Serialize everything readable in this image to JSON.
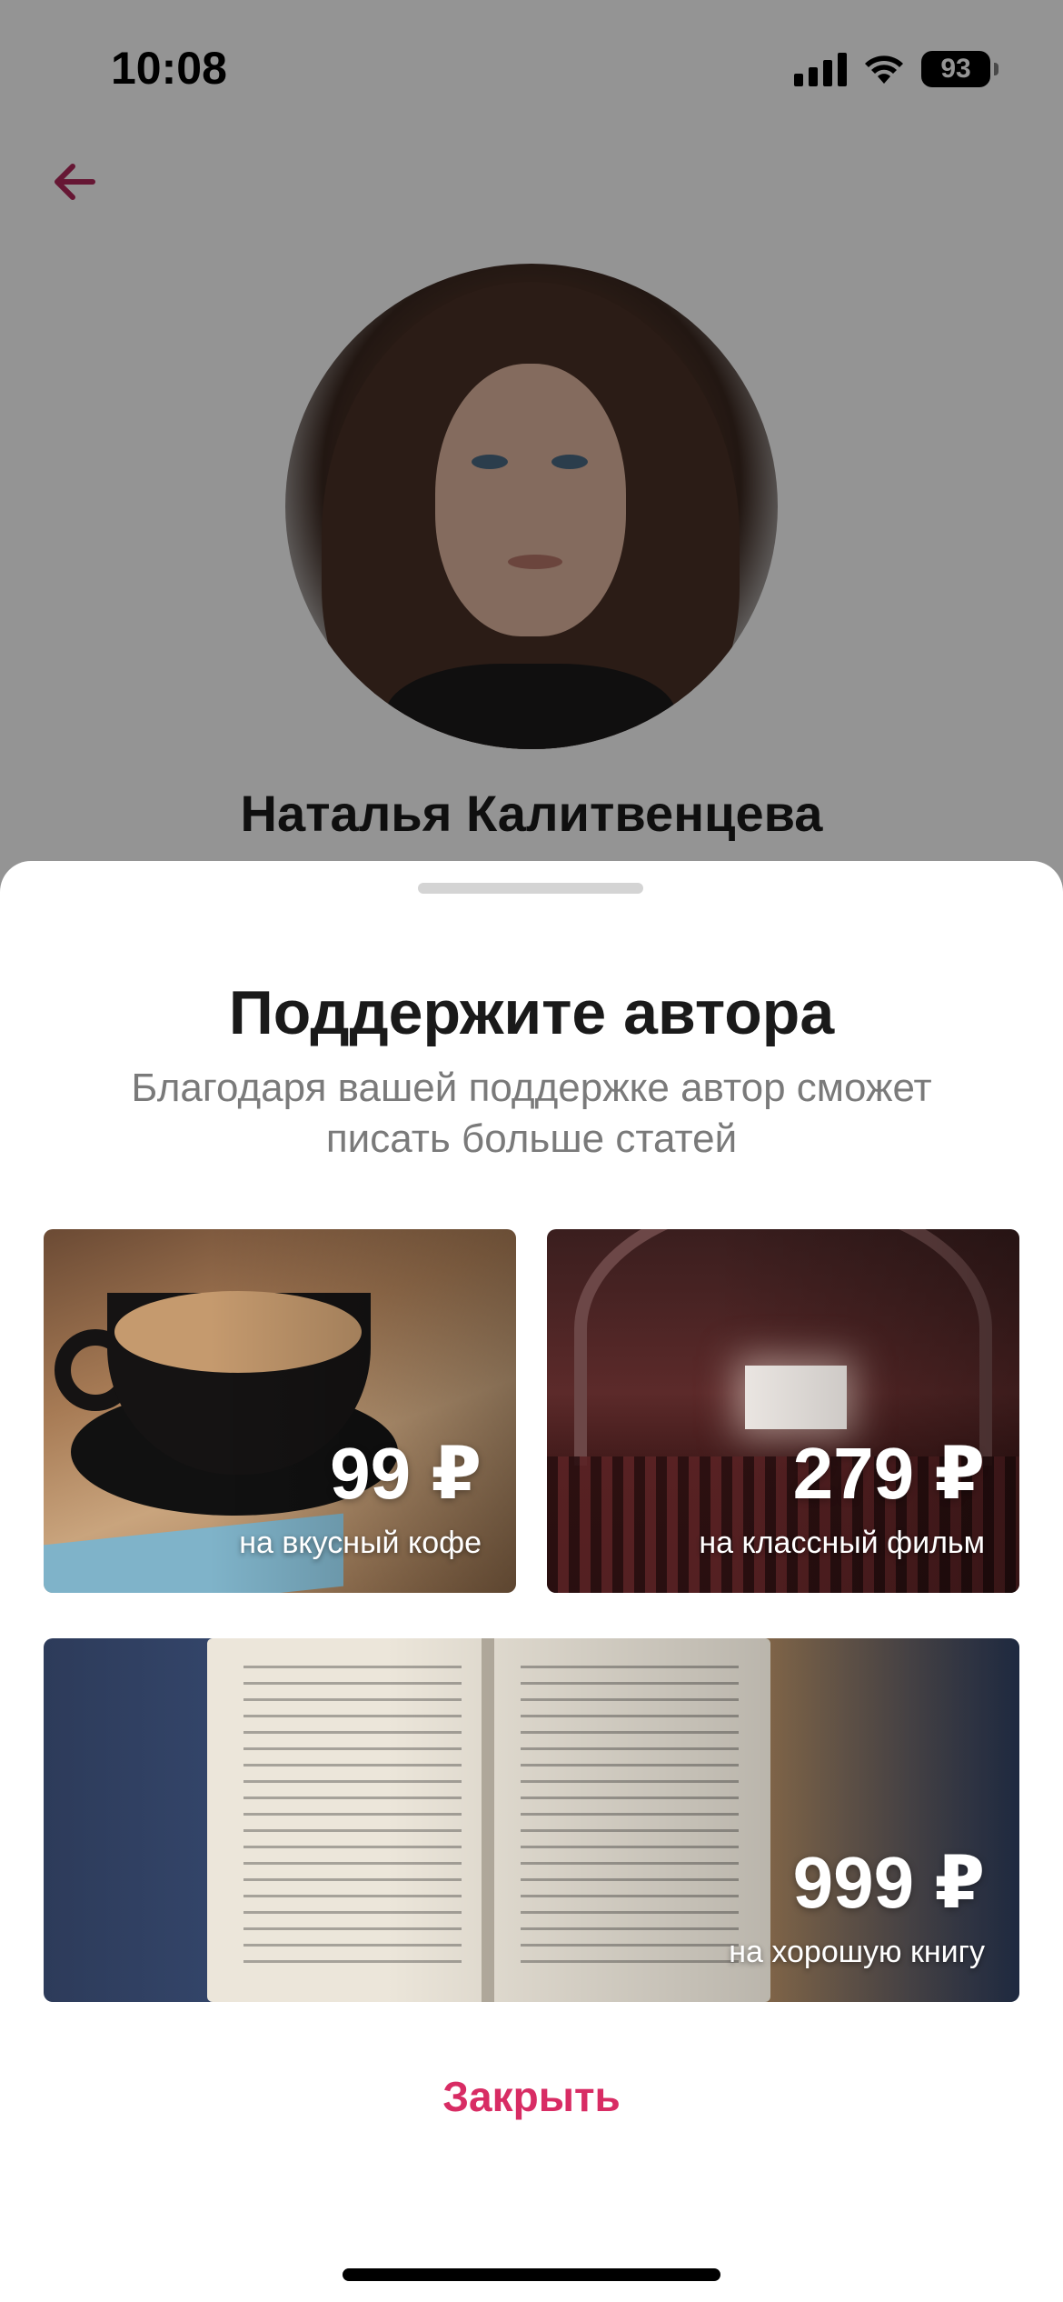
{
  "status_bar": {
    "time": "10:08",
    "battery": "93",
    "icons": [
      "signal-icon",
      "wifi-icon",
      "battery-icon"
    ]
  },
  "profile": {
    "back_icon": "arrow-left-icon",
    "author_name": "Наталья Калитвенцева",
    "accent_color": "#B0285A"
  },
  "sheet": {
    "title": "Поддержите автора",
    "subtitle": "Благодаря вашей поддержке автор сможет писать больше статей",
    "options": [
      {
        "price": "99 ₽",
        "caption": "на вкусный кофе",
        "image": "coffee-image"
      },
      {
        "price": "279 ₽",
        "caption": "на классный фильм",
        "image": "cinema-image"
      },
      {
        "price": "999 ₽",
        "caption": "на хорошую книгу",
        "image": "book-image"
      }
    ],
    "close_label": "Закрыть",
    "close_color": "#D82C64"
  }
}
